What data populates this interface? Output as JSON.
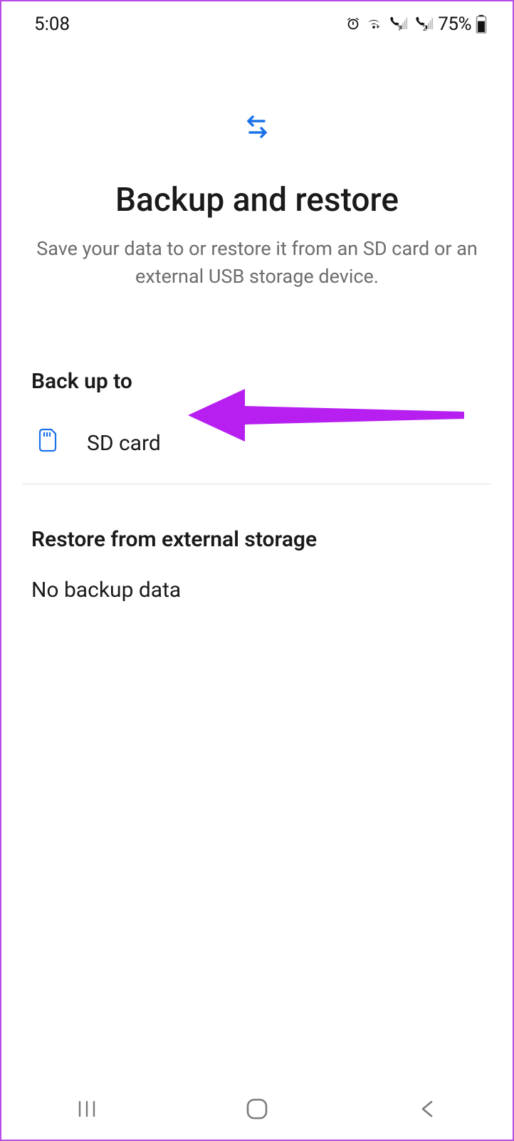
{
  "status": {
    "time": "5:08",
    "battery_pct": "75%"
  },
  "hero": {
    "title": "Backup and restore",
    "subtitle": "Save your data to or restore it from an SD card or an external USB storage device."
  },
  "backup": {
    "section_title": "Back up to",
    "sd_card_label": "SD card"
  },
  "restore": {
    "section_title": "Restore from external storage",
    "empty_label": "No backup data"
  },
  "colors": {
    "accent_blue": "#1a73e8",
    "annotation_purple": "#b61ff0"
  }
}
